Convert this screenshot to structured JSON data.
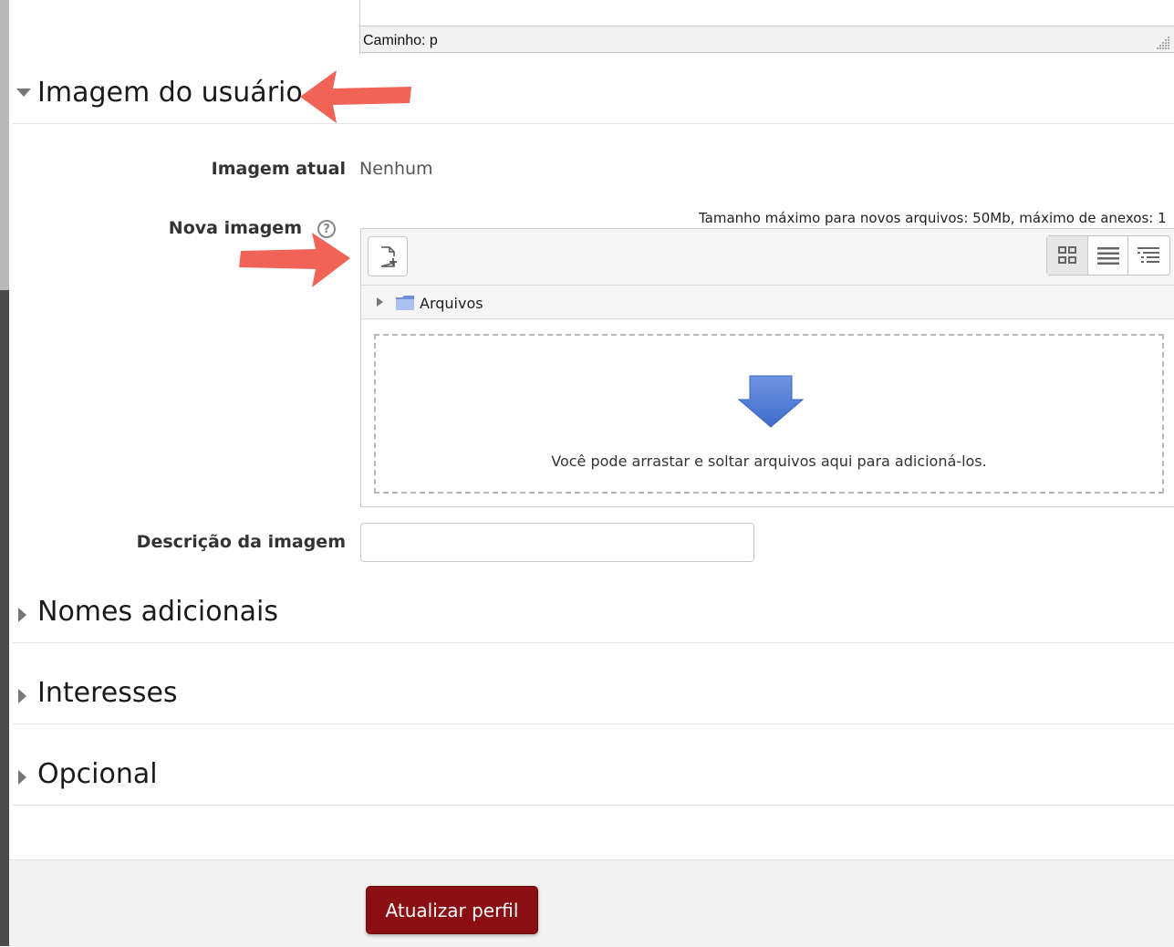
{
  "editor": {
    "path_label": "Caminho: p"
  },
  "sections": {
    "user_image": {
      "title": "Imagem do usuário",
      "expanded": true
    },
    "additional_names": {
      "title": "Nomes adicionais",
      "expanded": false
    },
    "interests": {
      "title": "Interesses",
      "expanded": false
    },
    "optional": {
      "title": "Opcional",
      "expanded": false
    }
  },
  "fields": {
    "current_image": {
      "label": "Imagem atual",
      "value": "Nenhum"
    },
    "new_image": {
      "label": "Nova imagem",
      "help_icon": "question-circle-icon"
    },
    "image_description": {
      "label": "Descrição da imagem",
      "value": "",
      "placeholder": ""
    }
  },
  "filepicker": {
    "max_size_text": "Tamanho máximo para novos arquivos: 50Mb, máximo de anexos: 1",
    "add_icon": "add-file-icon",
    "view_icons": [
      "grid-view-icon",
      "list-view-icon",
      "tree-view-icon"
    ],
    "folder_name": "Arquivos",
    "drop_message": "Você pode arrastar e soltar arquivos aqui para adicioná-los."
  },
  "actions": {
    "submit_label": "Atualizar perfil"
  },
  "colors": {
    "primary_button": "#8b0f12",
    "annotation_arrow": "#f06356",
    "drop_arrow": "#5b84d6"
  }
}
